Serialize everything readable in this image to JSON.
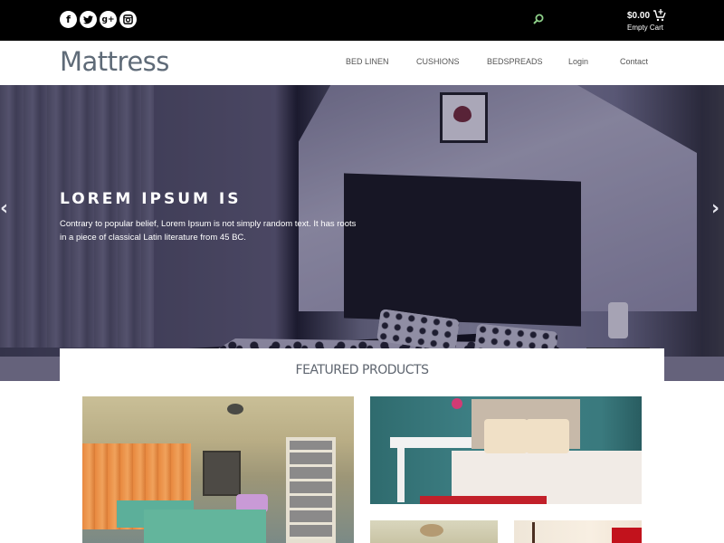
{
  "topbar": {
    "social_icons": [
      {
        "name": "facebook-icon",
        "glyph": "f"
      },
      {
        "name": "twitter-icon",
        "glyph": "t"
      },
      {
        "name": "google-plus-icon",
        "glyph": "g+"
      },
      {
        "name": "instagram-icon",
        "glyph": "ig"
      }
    ],
    "search_icon": "search-icon",
    "cart": {
      "amount": "$0.00",
      "label": "Empty Cart",
      "icon": "cart-icon"
    },
    "search_color": "#8fd18a"
  },
  "header": {
    "logo": "Mattress",
    "nav": [
      "BED LINEN",
      "CUSHIONS",
      "BEDSPREADS",
      "Login",
      "Contact"
    ]
  },
  "hero": {
    "title": "LOREM IPSUM IS",
    "text": "Contrary to popular belief, Lorem Ipsum is not simply random text. It has roots in a piece of classical Latin literature from 45 BC.",
    "prev_arrow": "‹",
    "next_arrow": "›"
  },
  "featured": {
    "title": "FEATURED PRODUCTS",
    "products": [
      {
        "name": "sunroom-twin-beds"
      },
      {
        "name": "teal-bedroom-floral-pillows"
      },
      {
        "name": "ceiling-fan-room"
      },
      {
        "name": "four-poster-bed-red-curtain"
      }
    ]
  },
  "colors": {
    "topbar_bg": "#000000",
    "logo": "#5f6b78",
    "featured_title": "#5f6670"
  }
}
